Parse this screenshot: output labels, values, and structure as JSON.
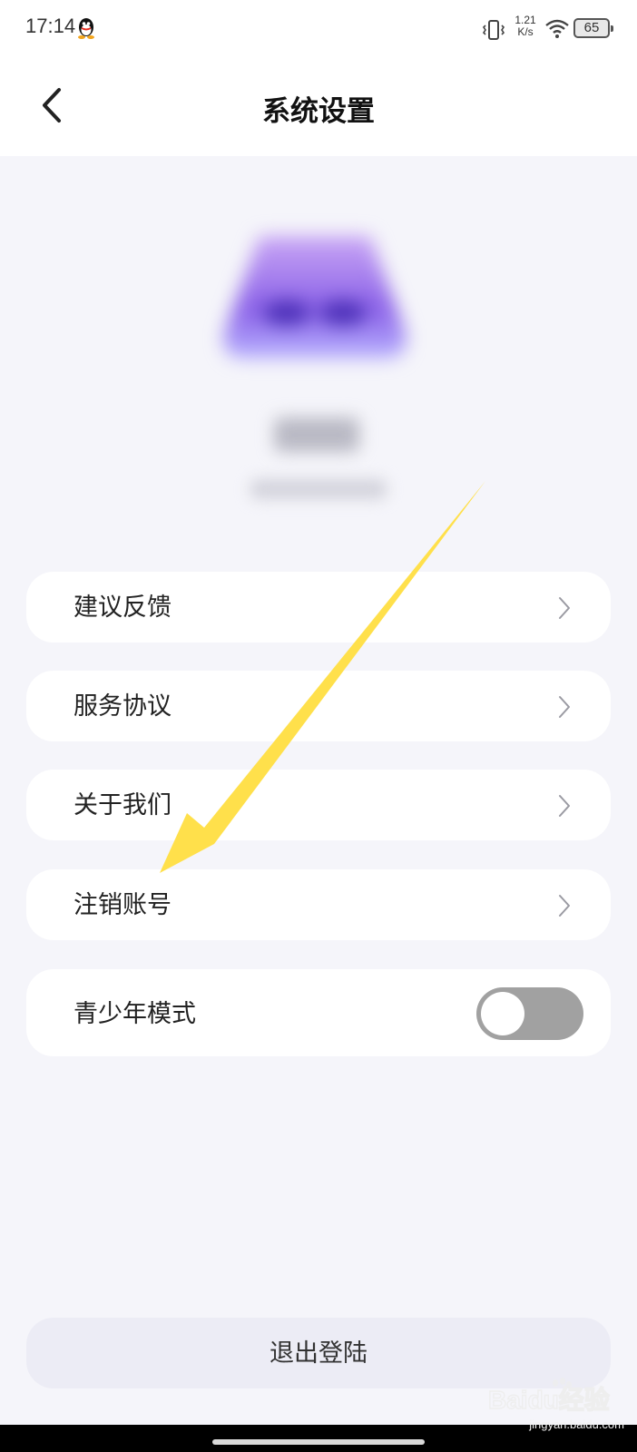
{
  "status_bar": {
    "time": "17:14",
    "net_speed_value": "1.21",
    "net_speed_unit": "K/s",
    "battery": "65"
  },
  "header": {
    "title": "系统设置"
  },
  "menu": {
    "items": [
      {
        "label": "建议反馈"
      },
      {
        "label": "服务协议"
      },
      {
        "label": "关于我们"
      },
      {
        "label": "注销账号"
      }
    ],
    "teen_mode": {
      "label": "青少年模式",
      "enabled": false
    }
  },
  "logout": {
    "label": "退出登陆"
  },
  "watermark": {
    "brand": "Baidu经验",
    "url": "jingyan.baidu.com"
  },
  "colors": {
    "annotation_arrow": "#ffe04b",
    "toggle_off": "#a1a1a1",
    "background": "#f5f5fa"
  }
}
